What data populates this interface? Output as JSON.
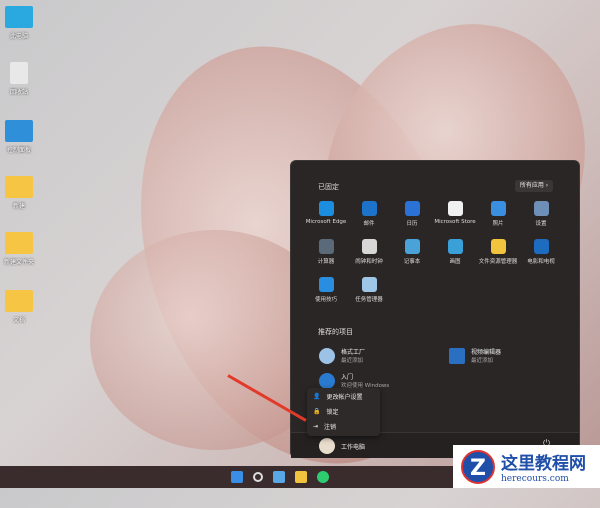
{
  "desktop": {
    "icons": [
      {
        "label": "此电脑",
        "color": "#29a9e0"
      },
      {
        "label": "回收站",
        "color": "#e8e8e8"
      },
      {
        "label": "控制面板",
        "color": "#2f8fd8"
      },
      {
        "label": "新建",
        "color": "#f5c543"
      },
      {
        "label": "新建文件夹",
        "color": "#f5c543"
      },
      {
        "label": "文档",
        "color": "#f5c543"
      }
    ]
  },
  "start": {
    "pinned_title": "已固定",
    "all_apps": "所有应用",
    "apps": [
      {
        "label": "Microsoft Edge",
        "color": "#1b8ee0"
      },
      {
        "label": "邮件",
        "color": "#1d73c9"
      },
      {
        "label": "日历",
        "color": "#2a72d6"
      },
      {
        "label": "Microsoft Store",
        "color": "#f1f1f1"
      },
      {
        "label": "照片",
        "color": "#3b8fe0"
      },
      {
        "label": "设置",
        "color": "#6d8fb8"
      },
      {
        "label": "计算器",
        "color": "#5a6a78"
      },
      {
        "label": "闹钟和时钟",
        "color": "#d7d7d7"
      },
      {
        "label": "记事本",
        "color": "#4aa3d8"
      },
      {
        "label": "画图",
        "color": "#3aa0d8"
      },
      {
        "label": "文件资源管理器",
        "color": "#f2c33c"
      },
      {
        "label": "电影和电视",
        "color": "#1e6cc0"
      },
      {
        "label": "使用技巧",
        "color": "#2a8ee0"
      },
      {
        "label": "任务管理器",
        "color": "#9ec6e6"
      }
    ],
    "recommended_title": "推荐的项目",
    "recommended": [
      {
        "name": "格式工厂",
        "sub": "最近添加",
        "color": "#9cc3e6"
      },
      {
        "name": "视频编辑器",
        "sub": "最近添加",
        "color": "#2b6fc0"
      },
      {
        "name": "入门",
        "sub": "欢迎使用 Windows",
        "color": "#2a7ad0"
      }
    ],
    "user": "工作电脑"
  },
  "user_menu": [
    {
      "label": "更改帐户设置",
      "icon": "person-gear"
    },
    {
      "label": "锁定",
      "icon": "lock"
    },
    {
      "label": "注销",
      "icon": "sign-out"
    }
  ],
  "watermark": {
    "title": "这里教程网",
    "url": "herecours.com"
  }
}
